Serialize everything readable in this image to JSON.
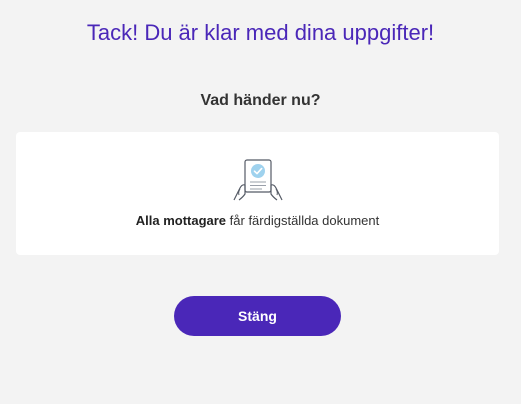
{
  "header": {
    "title": "Tack! Du är klar med dina uppgifter!"
  },
  "info": {
    "subtitle": "Vad händer nu?",
    "card": {
      "icon": "document-signed-icon",
      "text_strong": "Alla mottagare",
      "text_rest": " får färdigställda dokument"
    }
  },
  "actions": {
    "close_label": "Stäng"
  },
  "colors": {
    "accent": "#4a27b8",
    "background": "#f3f3f3",
    "card": "#ffffff",
    "icon_check": "#9fd2ee"
  }
}
